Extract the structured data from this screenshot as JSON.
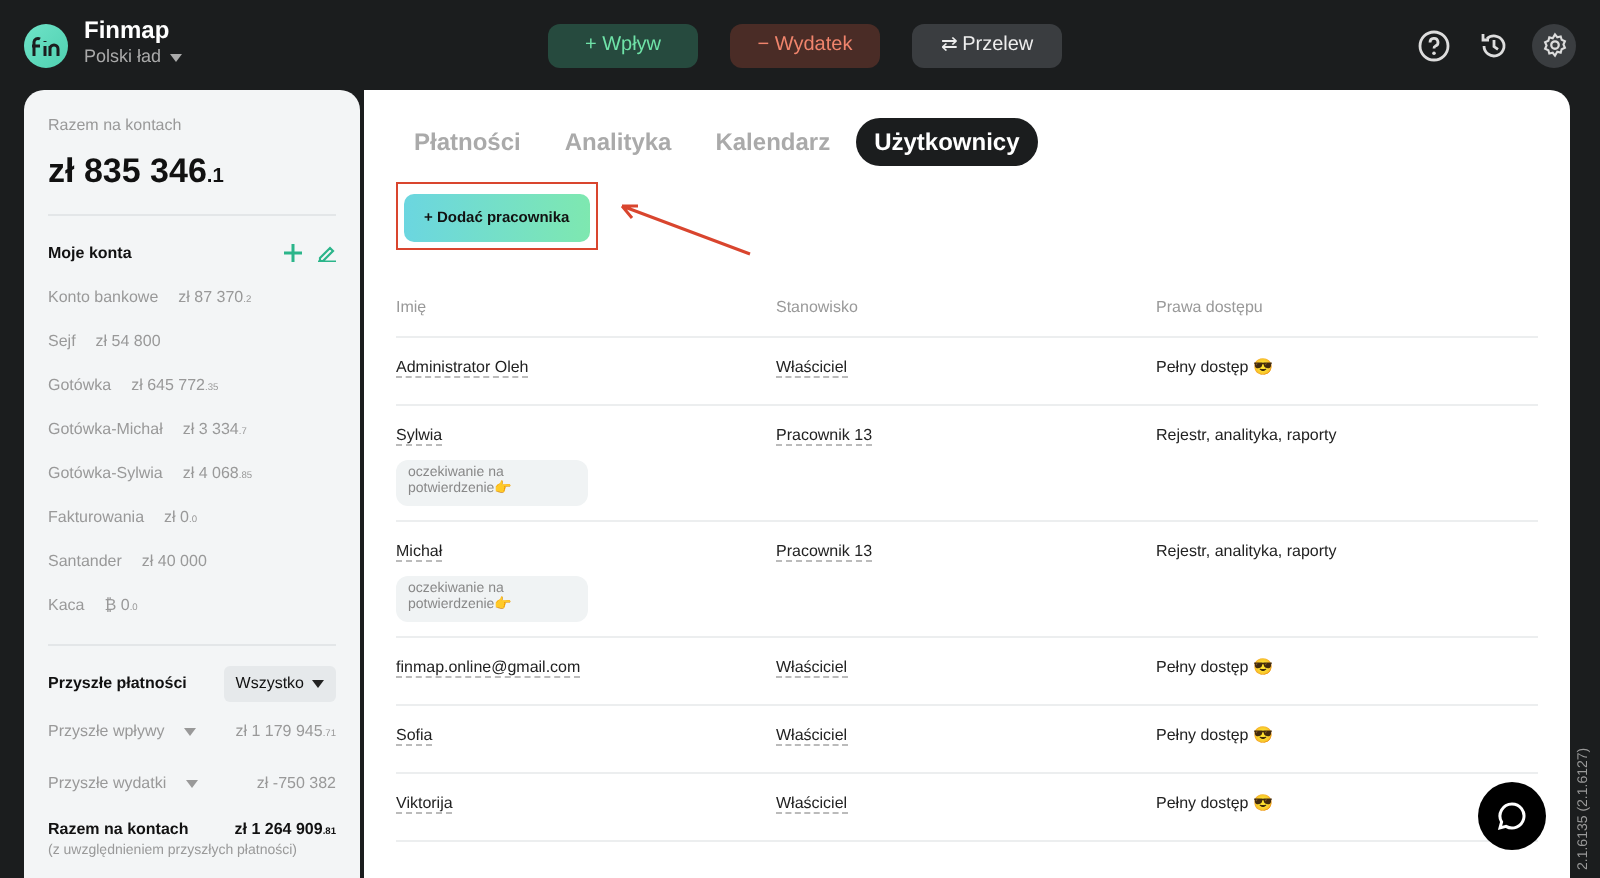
{
  "header": {
    "app_name": "Finmap",
    "company": "Polski ład",
    "actions": [
      {
        "kind": "income",
        "label": "+ Wpływ"
      },
      {
        "kind": "expense",
        "label": "− Wydatek"
      },
      {
        "kind": "transfer",
        "label": "⇄ Przelew"
      }
    ]
  },
  "sidebar": {
    "total_label": "Razem na kontach",
    "total": "zł 835 346",
    "total_cents": ".1",
    "accounts_title": "Moje konta",
    "accounts": [
      {
        "name": "Konto bankowe",
        "amount": "zł 87 370",
        "cents": ".2"
      },
      {
        "name": "Sejf",
        "amount": "zł 54 800"
      },
      {
        "name": "Gotówka",
        "amount": "zł 645 772",
        "cents": ".35"
      },
      {
        "name": "Gotówka-Michał",
        "amount": "zł 3 334",
        "cents": ".7"
      },
      {
        "name": "Gotówka-Sylwia",
        "amount": "zł 4 068",
        "cents": ".85"
      },
      {
        "name": "Fakturowania",
        "amount": "zł 0",
        "cents": ".0"
      },
      {
        "name": "Santander",
        "amount": "zł 40 000"
      },
      {
        "name": "Kaca",
        "amount": "₿ 0",
        "cents": ".0"
      }
    ],
    "future_title": "Przyszłe płatności",
    "future_filter": "Wszystko",
    "future": [
      {
        "label": "Przyszłe wpływy",
        "amount": "zł 1 179 945",
        "cents": ".71"
      },
      {
        "label": "Przyszłe wydatki",
        "amount": "zł -750 382"
      }
    ],
    "grand_label": "Razem na kontach",
    "grand_total": "zł 1 264 909",
    "grand_cents": ".81",
    "grand_note": "(z uwzględnieniem przyszłych płatności)"
  },
  "tabs": [
    {
      "label": "Płatności",
      "selected": false
    },
    {
      "label": "Analityka",
      "selected": false
    },
    {
      "label": "Kalendarz",
      "selected": false
    },
    {
      "label": "Użytkownicy",
      "selected": true
    }
  ],
  "add_button": "+ Dodać pracownika",
  "table": {
    "columns": [
      "Imię",
      "Stanowisko",
      "Prawa dostępu"
    ],
    "rows": [
      {
        "name": "Administrator Oleh",
        "position": "Właściciel",
        "access": "Pełny dostęp 😎"
      },
      {
        "name": "Sylwia",
        "status": "oczekiwanie na potwierdzenie👉",
        "position": "Pracownik 13",
        "access": "Rejestr, analityka, raporty"
      },
      {
        "name": "Michał",
        "status": "oczekiwanie na potwierdzenie👉",
        "position": "Pracownik 13",
        "access": "Rejestr, analityka, raporty"
      },
      {
        "name": "finmap.online@gmail.com",
        "position": "Właściciel",
        "access": "Pełny dostęp 😎"
      },
      {
        "name": "Sofia",
        "position": "Właściciel",
        "access": "Pełny dostęp 😎"
      },
      {
        "name": "Viktorija",
        "position": "Właściciel",
        "access": "Pełny dostęp 😎"
      }
    ]
  },
  "version": "2.1.6135 (2.1.6127)"
}
